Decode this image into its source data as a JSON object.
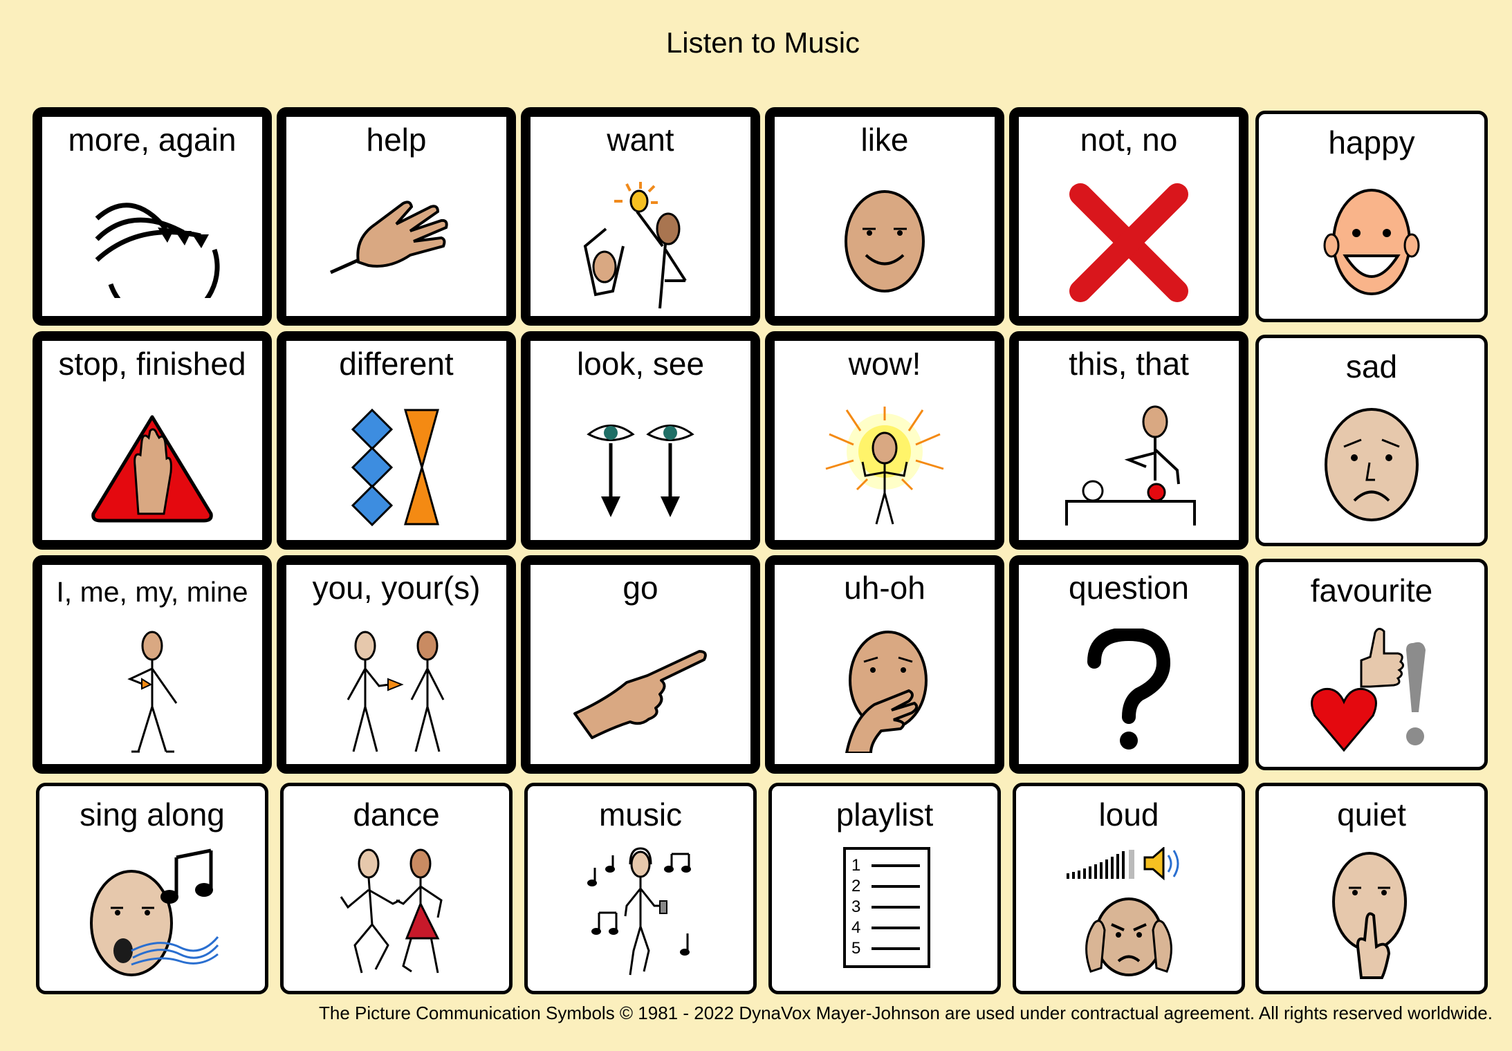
{
  "page_title": "Listen to Music",
  "footer": "The Picture Communication Symbols © 1981 - 2022 DynaVox Mayer-Johnson are used under contractual agreement. All rights reserved worldwide.",
  "cells": [
    {
      "label": "more, again",
      "icon": "more-again-arrows-icon"
    },
    {
      "label": "help",
      "icon": "help-hand-icon"
    },
    {
      "label": "want",
      "icon": "want-figures-icon"
    },
    {
      "label": "like",
      "icon": "like-face-icon"
    },
    {
      "label": "not, no",
      "icon": "red-x-icon"
    },
    {
      "label": "happy",
      "icon": "happy-face-icon"
    },
    {
      "label": "stop, finished",
      "icon": "stop-sign-hand-icon"
    },
    {
      "label": "different",
      "icon": "different-shapes-icon"
    },
    {
      "label": "look, see",
      "icon": "eyes-arrows-icon"
    },
    {
      "label": "wow!",
      "icon": "wow-figure-icon"
    },
    {
      "label": "this, that",
      "icon": "pointing-at-table-icon"
    },
    {
      "label": "sad",
      "icon": "sad-face-icon"
    },
    {
      "label": "I, me, my, mine",
      "icon": "self-pointing-figure-icon"
    },
    {
      "label": "you, your(s)",
      "icon": "pointing-at-other-icon"
    },
    {
      "label": "go",
      "icon": "pointing-hand-icon"
    },
    {
      "label": "uh-oh",
      "icon": "uh-oh-face-icon"
    },
    {
      "label": "question",
      "icon": "question-mark-icon"
    },
    {
      "label": "favourite",
      "icon": "heart-thumbs-up-icon"
    },
    {
      "label": "sing along",
      "icon": "singing-face-notes-icon"
    },
    {
      "label": "dance",
      "icon": "dancing-figures-icon"
    },
    {
      "label": "music",
      "icon": "music-listener-icon"
    },
    {
      "label": "playlist",
      "icon": "numbered-list-icon"
    },
    {
      "label": "loud",
      "icon": "loud-volume-face-icon"
    },
    {
      "label": "quiet",
      "icon": "shush-face-icon"
    }
  ],
  "playlist_numbers": [
    "1",
    "2",
    "3",
    "4",
    "5"
  ]
}
